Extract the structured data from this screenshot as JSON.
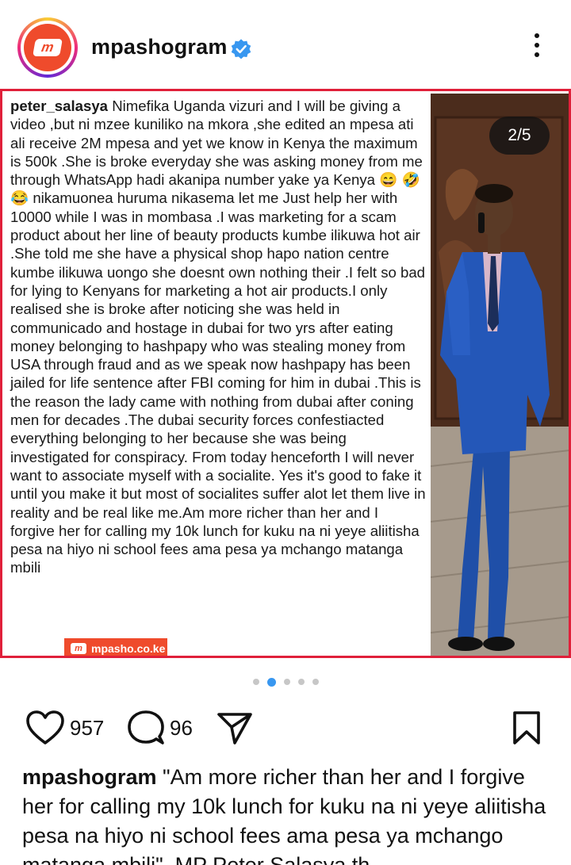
{
  "header": {
    "username": "mpashogram",
    "avatar_logo": "m"
  },
  "post": {
    "counter": "2/5",
    "text_author": "peter_salasya",
    "text_body": " Nimefika Uganda vizuri and I will be giving a video ,but ni mzee kuniliko na mkora ,she edited an mpesa ati ali receive 2M mpesa  and yet we know in Kenya the maximum is 500k .She is broke everyday she was asking  money from me through WhatsApp hadi akanipa number yake ya Kenya 😄 🤣 😂 nikamuonea huruma nikasema let me Just help her with 10000 while I was in mombasa .I was marketing for a scam  product about her line of beauty products kumbe ilikuwa hot air .She told me she have a physical shop hapo nation centre kumbe ilikuwa uongo she doesnt own nothing their .I felt so bad for lying to Kenyans for marketing a hot air products.I only realised she is broke after noticing she was held in communicado and hostage in dubai for two yrs after eating money belonging to hashpapy who was stealing money from USA through fraud and  as we speak now hashpapy has been jailed for  life sentence after FBI coming for him in dubai .This is the reason the lady came with nothing from dubai after coning men for decades .The dubai security forces confestiacted everything belonging to her because she was being investigated for conspiracy. From today henceforth I will never want to associate myself with a socialite. Yes it's good to fake it until you make it but most of socialites suffer alot let them live in reality and be real like me.Am more richer than her and I forgive her for calling my 10k lunch for kuku na ni yeye aliitisha pesa na  hiyo ni school fees ama pesa ya mchango matanga mbili",
    "watermark": "mpasho.co.ke",
    "watermark_logo": "m",
    "dots_total": 5,
    "dots_active": 2
  },
  "actions": {
    "likes": "957",
    "comments": "96"
  },
  "caption": {
    "username": "mpashogram",
    "text": " \"Am more richer than her and I forgive her for calling my 10k lunch for kuku na ni yeye aliitisha pesa na hiyo ni school fees ama pesa ya mchango matanga mbili\". MP Peter Salasya th"
  },
  "colors": {
    "brand": "#ef4b2c",
    "frame": "#e0203a",
    "verified": "#3897f0",
    "dot_active": "#3897f0"
  },
  "icons": [
    "more-options-icon",
    "verified-badge-icon",
    "heart-icon",
    "comment-icon",
    "share-icon",
    "bookmark-icon"
  ]
}
